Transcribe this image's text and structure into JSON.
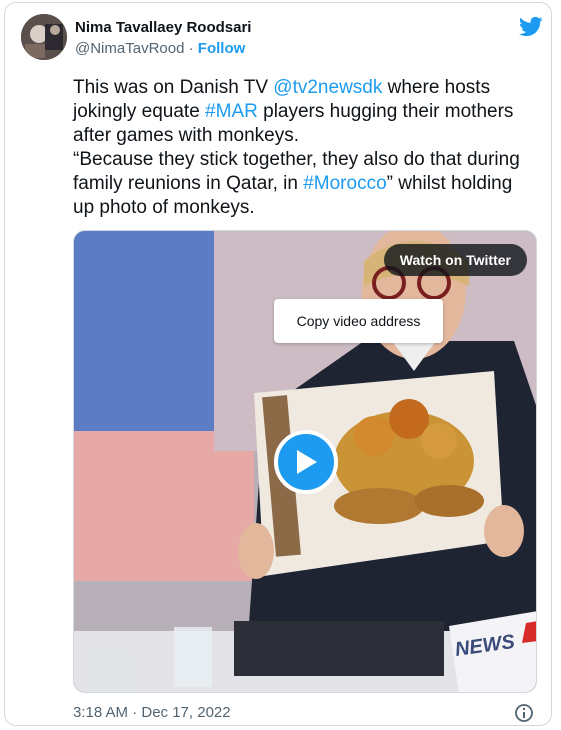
{
  "author": {
    "name": "Nima Tavallaey Roodsari",
    "handle": "@NimaTavRood",
    "separator": " · ",
    "follow_label": "Follow"
  },
  "tweet": {
    "line1_a": "This was on Danish TV ",
    "mention": "@tv2newsdk",
    "line1_b": " where hosts jokingly equate ",
    "hashtag1": "#MAR",
    "line1_c": " players hugging their mothers after games with monkeys.",
    "line2_a": "“Because they stick together, they also do that during family reunions in Qatar, in ",
    "hashtag2": "#Morocco",
    "line2_b": "” whilst holding up photo of monkeys."
  },
  "media": {
    "watch_label": "Watch on Twitter",
    "copy_label": "Copy video address",
    "overlay_text": "NEWS"
  },
  "footer": {
    "timestamp": "3:18 AM · Dec 17, 2022"
  },
  "icons": {
    "brand": "twitter-bird-icon",
    "play": "play-icon",
    "info": "info-icon"
  },
  "colors": {
    "accent": "#1d9bf0",
    "text": "#0f1419",
    "secondary": "#536471"
  }
}
